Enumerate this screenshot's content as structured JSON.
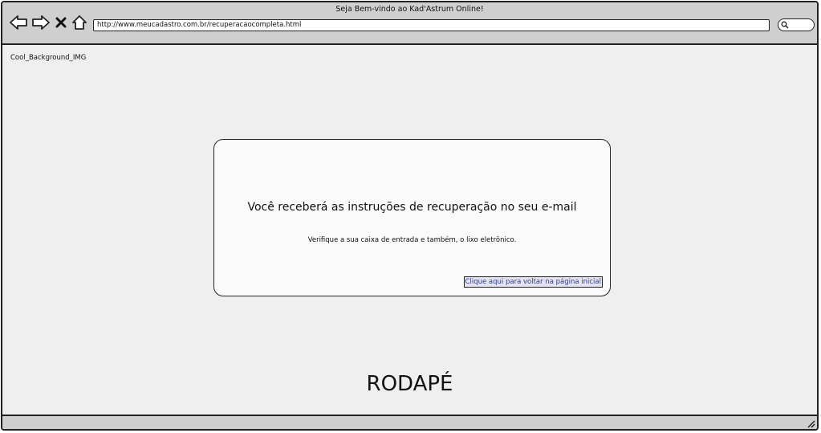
{
  "window": {
    "title": "Seja Bem-vindo ao Kad'Astrum Online!",
    "url": "http://www.meucadastro.com.br/recuperacaocompleta.html"
  },
  "toolbar": {
    "back_icon": "arrow-left-icon",
    "forward_icon": "arrow-right-icon",
    "stop_icon": "close-icon",
    "home_icon": "home-icon",
    "search_icon": "search-icon"
  },
  "content": {
    "background_label": "Cool_Background_IMG",
    "card": {
      "heading": "Você receberá as instruções de recuperação no seu e-mail",
      "subtext": "Verifique a sua caixa de entrada e também, o lixo eletrônico.",
      "back_link": "Clique aqui para voltar na página inicial"
    },
    "footer": "RODAPÉ"
  }
}
